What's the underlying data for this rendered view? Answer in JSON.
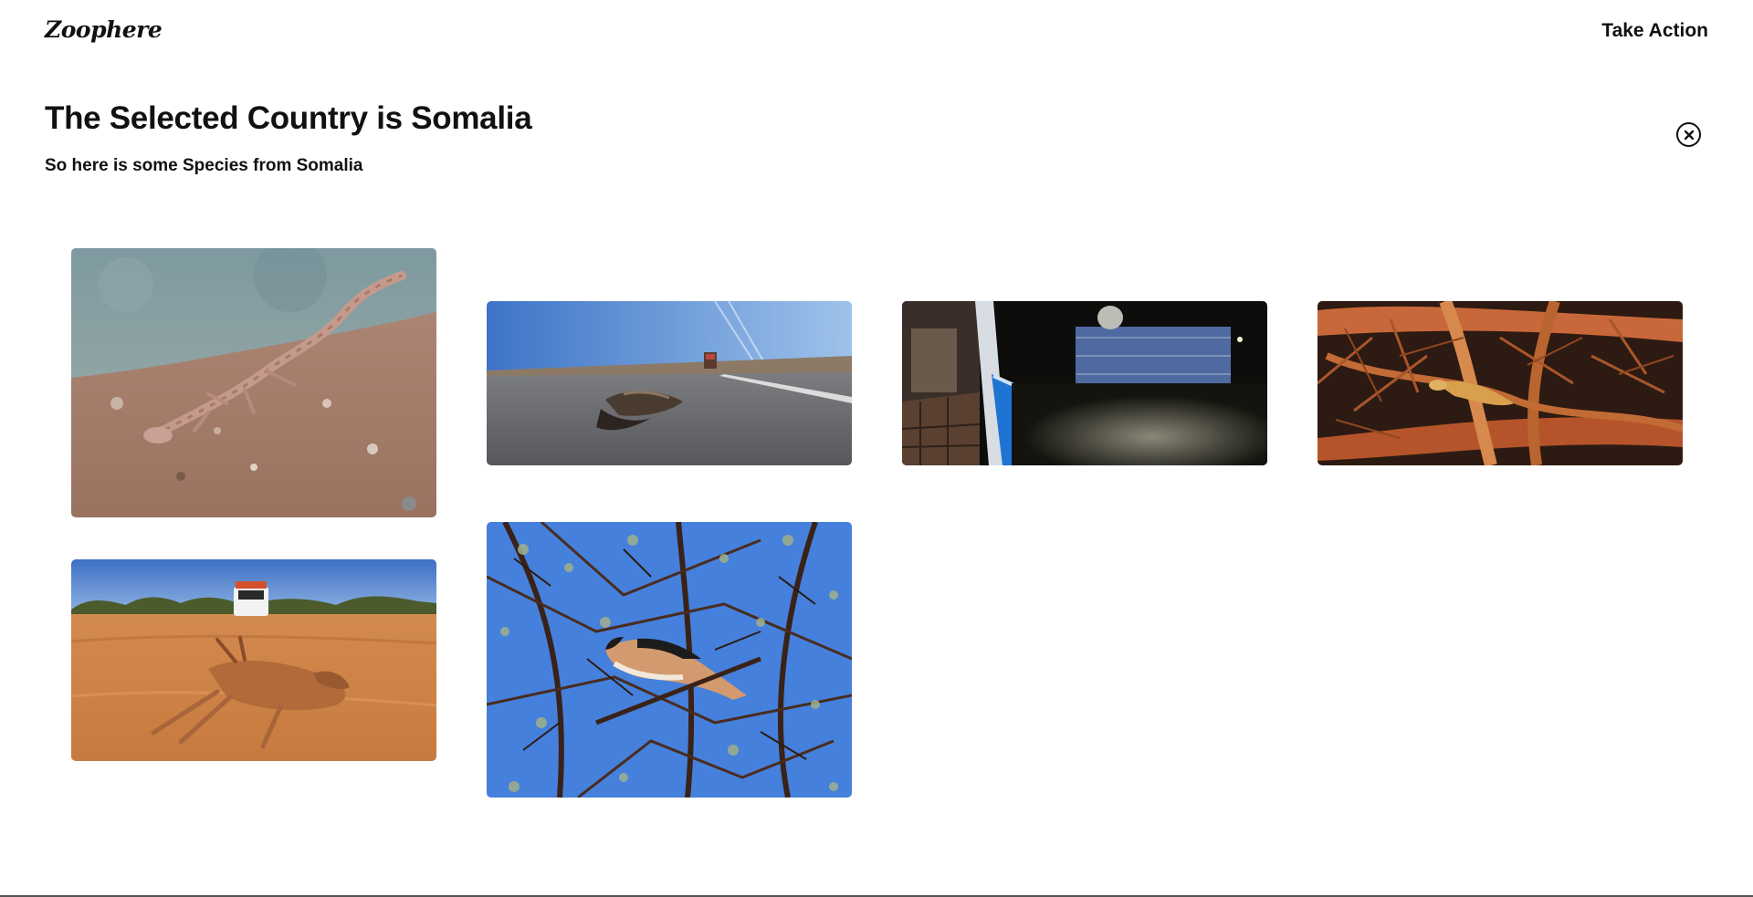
{
  "nav": {
    "logo": "Zoophere",
    "take_action": "Take Action"
  },
  "page": {
    "title": "The Selected Country is Somalia",
    "subtitle": "So here is some Species from Somalia"
  },
  "icons": {
    "close": "close-icon"
  },
  "gallery": {
    "photos": [
      "gecko-on-soil-photo",
      "roadkill-on-highway-photo",
      "flooded-yard-at-night-photo",
      "lizard-in-orange-branches-photo",
      "dikdik-on-sand-road-photo",
      "shrike-in-acacia-tree-photo"
    ]
  },
  "colors": {
    "background": "#ffffff",
    "text": "#111111",
    "sky": "#3b78d8"
  }
}
